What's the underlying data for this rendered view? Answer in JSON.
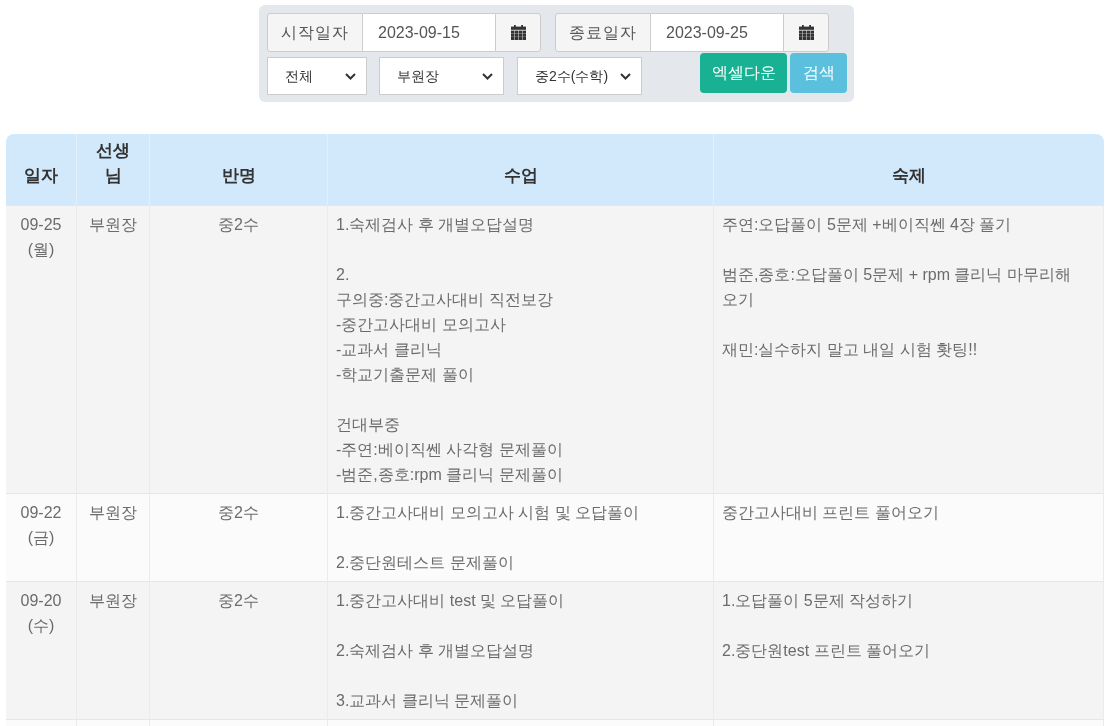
{
  "filters": {
    "date_range": [
      {
        "label": "시작일자",
        "value": "2023-09-15"
      },
      {
        "label": "종료일자",
        "value": "2023-09-25"
      }
    ],
    "selects": [
      {
        "value": "전체"
      },
      {
        "value": "부원장"
      },
      {
        "value": "중2수(수학)"
      }
    ],
    "buttons": [
      {
        "label": "엑셀다운",
        "kind": "excel"
      },
      {
        "label": "검색",
        "kind": "search"
      }
    ]
  },
  "table": {
    "columns": [
      "일자",
      "선생님",
      "반명",
      "수업",
      "숙제"
    ],
    "rows": [
      {
        "date": "09-25\n(월)",
        "teacher": "부원장",
        "class_name": "중2수",
        "lesson": "1.숙제검사 후 개별오답설명\n\n2.\n구의중:중간고사대비 직전보강\n-중간고사대비 모의고사\n-교과서 클리닉\n-학교기출문제 풀이\n\n건대부중\n-주연:베이직쎈 사각형 문제풀이\n-범준,종호:rpm 클리닉 문제풀이",
        "homework": "주연:오답풀이 5문제 +베이직쎈 4장 풀기\n\n범준,종호:오답풀이 5문제 + rpm 클리닉 마무리해오기\n\n재민:실수하지 말고 내일 시험 홧팅!!"
      },
      {
        "date": "09-22\n(금)",
        "teacher": "부원장",
        "class_name": "중2수",
        "lesson": "1.중간고사대비 모의고사 시험 및 오답풀이\n\n2.중단원테스트 문제풀이",
        "homework": "중간고사대비 프린트 풀어오기"
      },
      {
        "date": "09-20\n(수)",
        "teacher": "부원장",
        "class_name": "중2수",
        "lesson": "1.중간고사대비 test 및 오답풀이\n\n2.숙제검사 후 개별오답설명\n\n3.교과서 클리닉 문제풀이",
        "homework": "1.오답풀이 5문제 작성하기\n\n2.중단원test 프린트 풀어오기"
      }
    ]
  }
}
